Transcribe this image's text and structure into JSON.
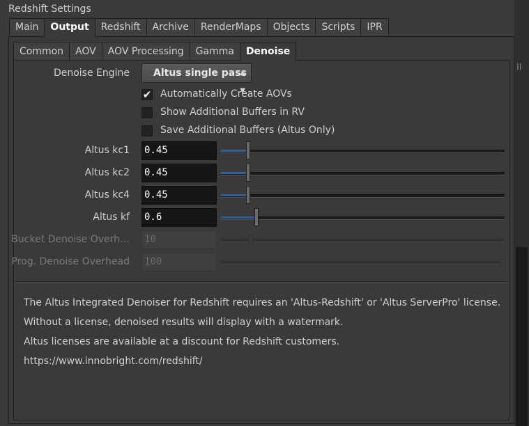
{
  "window": {
    "title": "Redshift Settings"
  },
  "main_tabs": [
    {
      "label": "Main"
    },
    {
      "label": "Output",
      "active": true
    },
    {
      "label": "Redshift"
    },
    {
      "label": "Archive"
    },
    {
      "label": "RenderMaps"
    },
    {
      "label": "Objects"
    },
    {
      "label": "Scripts"
    },
    {
      "label": "IPR"
    }
  ],
  "sub_tabs": [
    {
      "label": "Common"
    },
    {
      "label": "AOV"
    },
    {
      "label": "AOV Processing"
    },
    {
      "label": "Gamma"
    },
    {
      "label": "Denoise",
      "active": true
    }
  ],
  "denoise": {
    "engine_label": "Denoise Engine",
    "engine_value": "Altus single pass",
    "checkboxes": [
      {
        "label": "Automatically Create AOVs",
        "checked": true
      },
      {
        "label": "Show Additional Buffers in RV",
        "checked": false
      },
      {
        "label": "Save Additional Buffers (Altus Only)",
        "checked": false
      }
    ],
    "check_mark": "✔",
    "params": [
      {
        "label": "Altus kc1",
        "value": "0.45",
        "fraction": 0.09,
        "enabled": true
      },
      {
        "label": "Altus kc2",
        "value": "0.45",
        "fraction": 0.09,
        "enabled": true
      },
      {
        "label": "Altus kc4",
        "value": "0.45",
        "fraction": 0.09,
        "enabled": true
      },
      {
        "label": "Altus kf",
        "value": "0.6",
        "fraction": 0.12,
        "enabled": true
      },
      {
        "label": "Bucket Denoise Overh…",
        "value": "10",
        "fraction": 0.1,
        "enabled": false
      },
      {
        "label": "Prog. Denoise Overhead",
        "value": "100",
        "fraction": 1.0,
        "enabled": false
      }
    ]
  },
  "info_lines": [
    "The Altus Integrated Denoiser for Redshift requires an 'Altus-Redshift' or 'Altus ServerPro' license.",
    "Without a license, denoised results will display with a watermark.",
    "Altus licenses are available at a discount for Redshift customers.",
    "https://www.innobright.com/redshift/"
  ],
  "colors": {
    "accent": "#2f5fa5",
    "background": "#3a3a3a"
  }
}
